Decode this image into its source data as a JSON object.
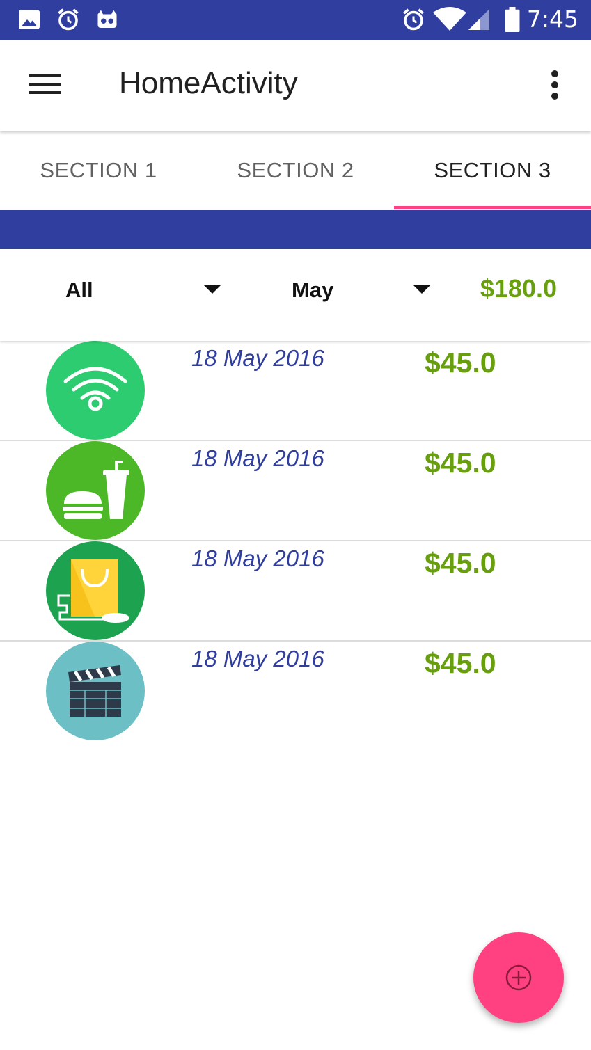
{
  "status_bar": {
    "time": "7:45",
    "left_icons": [
      "image-icon",
      "alarm-icon",
      "cyanogen-icon"
    ],
    "right_icons": [
      "alarm-icon",
      "wifi-icon",
      "signal-icon",
      "battery-icon"
    ]
  },
  "app_bar": {
    "title": "HomeActivity",
    "menu_icon": "hamburger-menu-icon",
    "overflow_icon": "more-vert-icon"
  },
  "tabs": [
    {
      "label": "SECTION 1",
      "active": false
    },
    {
      "label": "SECTION 2",
      "active": false
    },
    {
      "label": "SECTION 3",
      "active": true
    }
  ],
  "filters": {
    "category": "All",
    "month": "May",
    "total": "$180.0"
  },
  "items": [
    {
      "date": "18 May 2016",
      "amount": "$45.0",
      "icon": "wifi-category-icon",
      "color": "#2ECC71"
    },
    {
      "date": "18 May 2016",
      "amount": "$45.0",
      "icon": "food-category-icon",
      "color": "#4CB828"
    },
    {
      "date": "18 May 2016",
      "amount": "$45.0",
      "icon": "shopping-category-icon",
      "color": "#1DA350"
    },
    {
      "date": "18 May 2016",
      "amount": "$45.0",
      "icon": "movie-category-icon",
      "color": "#6BBFC5"
    }
  ],
  "fab": {
    "icon": "add-circle-icon"
  },
  "colors": {
    "primary": "#303F9F",
    "accent": "#FF4081",
    "amount_green": "#689F0E"
  }
}
